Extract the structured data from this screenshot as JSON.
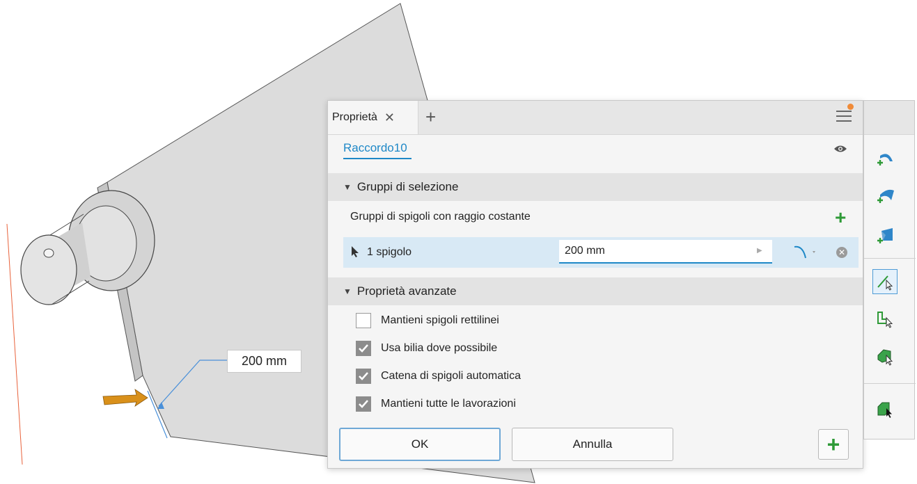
{
  "panel": {
    "tab_label": "Proprietà",
    "feature_name": "Raccordo10",
    "sections": {
      "selection": "Gruppi di selezione",
      "advanced": "Proprietà avanzate"
    },
    "group_label": "Gruppi di spigoli con raggio costante",
    "selection_row": {
      "label": "1 spigolo",
      "value": "200 mm"
    },
    "options": [
      {
        "label": "Mantieni spigoli rettilinei",
        "checked": false
      },
      {
        "label": "Usa bilia dove possibile",
        "checked": true
      },
      {
        "label": "Catena di spigoli automatica",
        "checked": true
      },
      {
        "label": "Mantieni tutte le lavorazioni",
        "checked": true
      }
    ],
    "buttons": {
      "ok": "OK",
      "cancel": "Annulla"
    }
  },
  "viewport": {
    "dimension_label": "200 mm"
  },
  "colors": {
    "accent": "#1e88c7",
    "green": "#2e9a37",
    "notification": "#f08b38",
    "arrow": "#d9901a"
  },
  "toolbar": {
    "icons": [
      "add-fillet-icon",
      "add-variable-fillet-icon",
      "add-setback-icon",
      "edge-select-icon",
      "loop-select-icon",
      "feature-select-icon",
      "solid-select-icon"
    ]
  }
}
